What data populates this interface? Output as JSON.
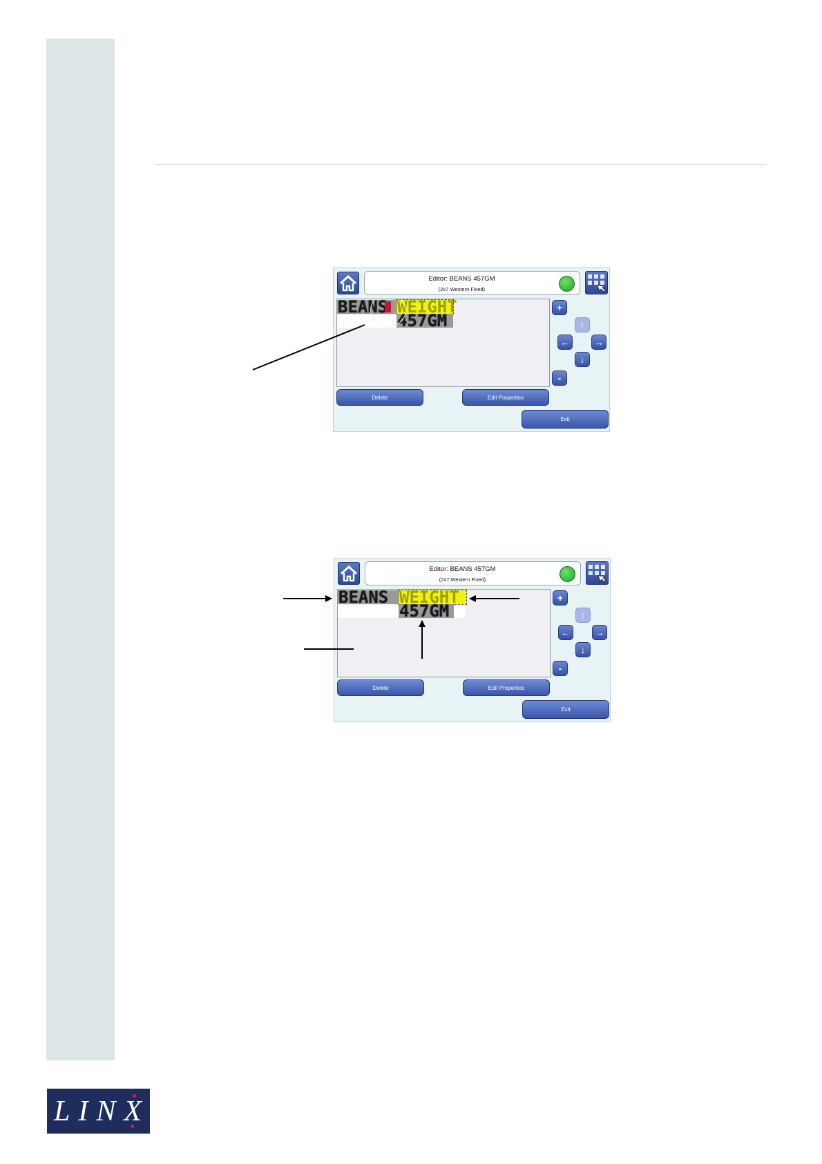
{
  "logo": {
    "text": "LINX"
  },
  "screens": [
    {
      "header": {
        "title": "Editor: BEANS 457GM",
        "subtitle": "(2x7 Western Fixed)"
      },
      "fields": {
        "beans": "BEANS",
        "weight": "WEIGHT",
        "gm": "457GM"
      },
      "buttons": {
        "plus": "+",
        "minus": "-",
        "up": "↑",
        "left": "←",
        "right": "→",
        "down": "↓",
        "delete": "Delete",
        "edit_properties": "Edit Properties",
        "exit": "Exit"
      }
    },
    {
      "header": {
        "title": "Editor: BEANS 457GM",
        "subtitle": "(2x7 Western Fixed)"
      },
      "fields": {
        "beans": "BEANS",
        "weight": "WEIGHT",
        "gm": "457GM"
      },
      "buttons": {
        "plus": "+",
        "minus": "-",
        "up": "↑",
        "left": "←",
        "right": "→",
        "down": "↓",
        "delete": "Delete",
        "edit_properties": "Edit Properties",
        "exit": "Exit"
      }
    }
  ],
  "colors": {
    "band": "#dde5e6",
    "logo_bg": "#1e2d5c",
    "logo_dot": "#d5202e",
    "screen_bg": "#e8f3f5",
    "button_blue": "#3a55aa",
    "selection_yellow": "#f2f212",
    "status_green": "#1ea52a"
  },
  "icons": [
    "home-icon",
    "keypad-icon",
    "status-light"
  ]
}
